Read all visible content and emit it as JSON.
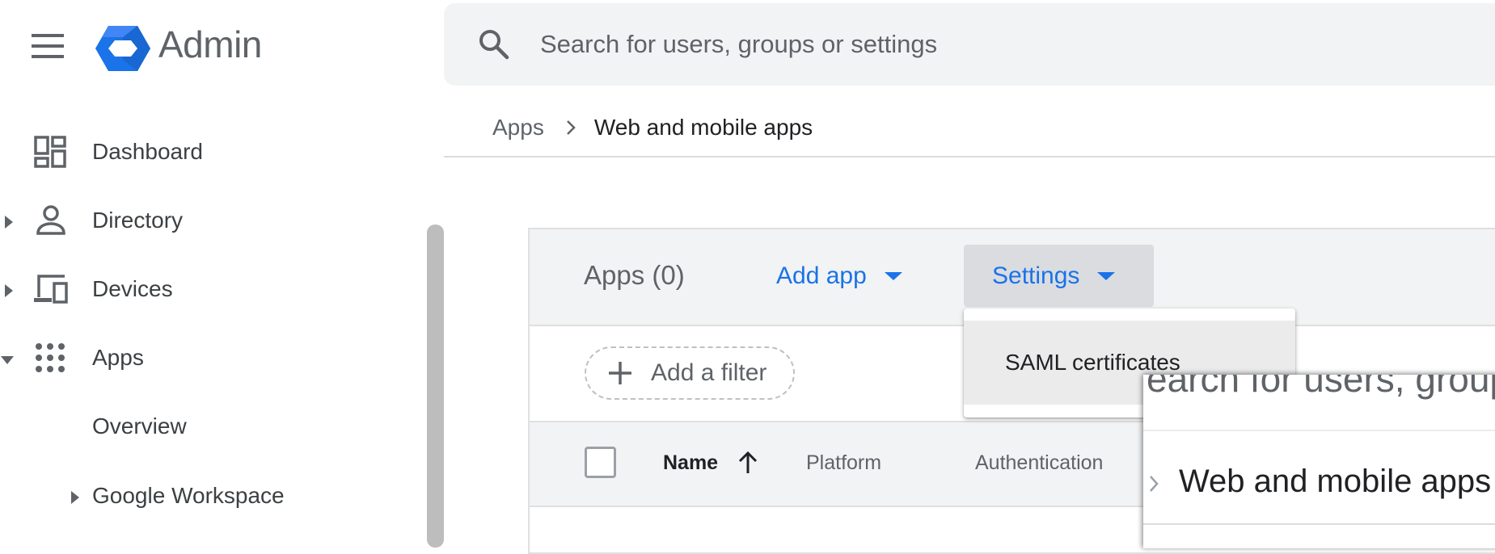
{
  "header": {
    "app_title": "Admin",
    "search_placeholder": "Search for users, groups or settings"
  },
  "breadcrumb": {
    "parent": "Apps",
    "current": "Web and mobile apps"
  },
  "sidebar": {
    "items": [
      {
        "label": "Dashboard",
        "icon": "dashboard-icon",
        "expandable": false
      },
      {
        "label": "Directory",
        "icon": "person-icon",
        "expandable": true,
        "expanded": false
      },
      {
        "label": "Devices",
        "icon": "devices-icon",
        "expandable": true,
        "expanded": false
      },
      {
        "label": "Apps",
        "icon": "apps-grid-icon",
        "expandable": true,
        "expanded": true
      }
    ],
    "sub_items": [
      {
        "label": "Overview",
        "expandable": false
      },
      {
        "label": "Google Workspace",
        "expandable": true,
        "expanded": false
      }
    ]
  },
  "card": {
    "title": "Apps (0)",
    "add_app_label": "Add app",
    "settings_label": "Settings",
    "filter_label": "Add a filter",
    "columns": [
      "Name",
      "Platform",
      "Authentication"
    ],
    "sort_direction": "ascending"
  },
  "settings_menu": {
    "items": [
      "SAML certificates"
    ]
  },
  "zoom": {
    "search_fragment": "earch for users, groups",
    "breadcrumb_text": "Web and mobile apps"
  },
  "colors": {
    "accent": "#1a73e8",
    "header_bg": "#f1f3f4",
    "text_secondary": "#5f6368"
  }
}
